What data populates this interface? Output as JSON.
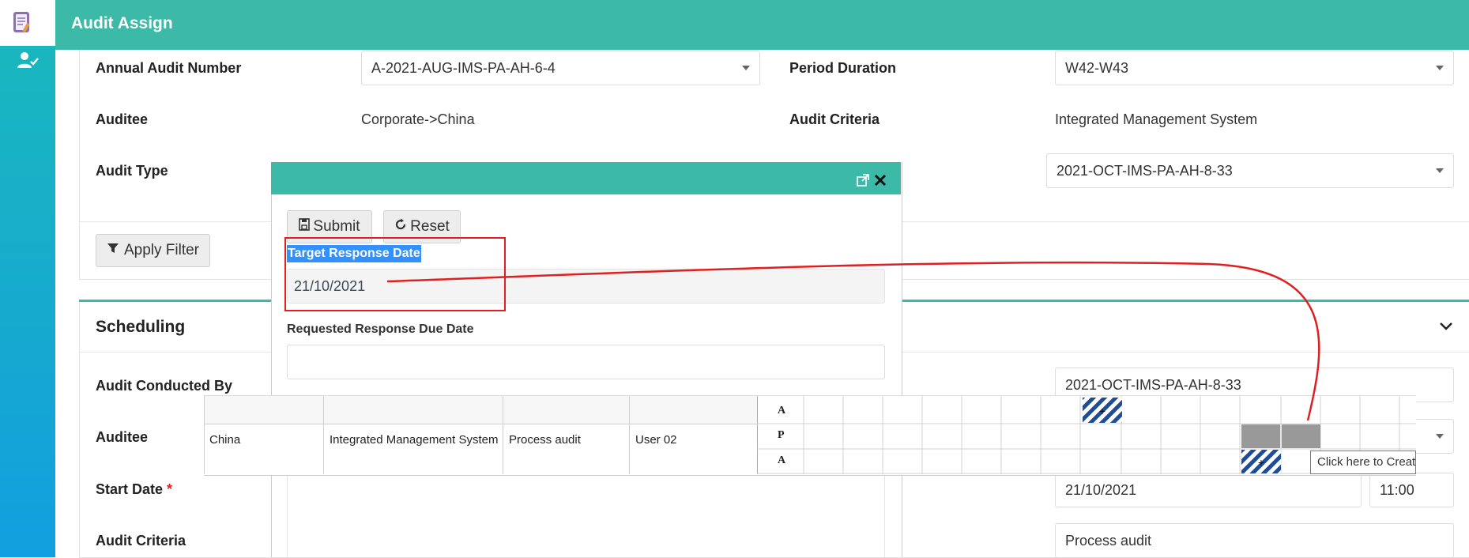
{
  "header": {
    "title": "Audit Assign"
  },
  "filters": {
    "annual_audit_number": {
      "label": "Annual Audit Number",
      "value": "A-2021-AUG-IMS-PA-AH-6-4"
    },
    "period_duration": {
      "label": "Period Duration",
      "value": "W42-W43"
    },
    "auditee": {
      "label": "Auditee",
      "value": "Corporate->China"
    },
    "audit_criteria": {
      "label": "Audit Criteria",
      "value": "Integrated Management System"
    },
    "audit_type": {
      "label": "Audit Type",
      "value": "2021-OCT-IMS-PA-AH-8-33"
    },
    "apply_filter_label": "Apply Filter"
  },
  "scheduling": {
    "title": "Scheduling",
    "audit_conducted_by": {
      "label": "Audit Conducted By",
      "value": "2021-OCT-IMS-PA-AH-8-33"
    },
    "auditee_label": "Auditee",
    "start_date": {
      "label": "Start Date",
      "required": "*",
      "value": "21/10/2021",
      "time": "11:00"
    },
    "audit_criteria": {
      "label": "Audit Criteria",
      "value": "Process audit"
    }
  },
  "modal": {
    "submit_label": "Submit",
    "reset_label": "Reset",
    "target_response_date": {
      "label": "Target Response Date",
      "value": "21/10/2021"
    },
    "requested_response_due_date": {
      "label": "Requested Response Due Date",
      "value": ""
    }
  },
  "grid": {
    "row": {
      "auditee": "China",
      "criteria": "Integrated Management System",
      "type": "Process audit",
      "user": "User 02"
    },
    "row_markers": [
      "A",
      "P",
      "A"
    ],
    "tooltip": "Click here to Create"
  },
  "colors": {
    "header": "#3db9a8",
    "annotation": "#e02020",
    "highlight": "#3390ff"
  }
}
